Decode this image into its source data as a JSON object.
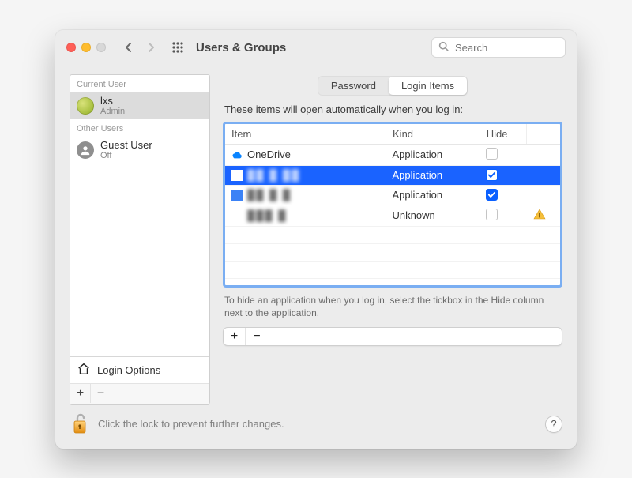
{
  "toolbar": {
    "title": "Users & Groups",
    "search_placeholder": "Search"
  },
  "sidebar": {
    "headers": {
      "current": "Current User",
      "other": "Other Users"
    },
    "current": {
      "name": "lxs",
      "role": "Admin"
    },
    "others": [
      {
        "name": "Guest User",
        "role": "Off"
      }
    ],
    "login_options_label": "Login Options"
  },
  "main": {
    "tabs": {
      "password": "Password",
      "login_items": "Login Items",
      "active": "login_items"
    },
    "description": "These items will open automatically when you log in:",
    "columns": {
      "item": "Item",
      "kind": "Kind",
      "hide": "Hide"
    },
    "rows": [
      {
        "name": "OneDrive",
        "kind": "Application",
        "hide": false,
        "icon": "cloud",
        "obscured": false,
        "selected": false,
        "warn": false
      },
      {
        "name": "",
        "kind": "Application",
        "hide": true,
        "icon": "generic",
        "obscured": true,
        "selected": true,
        "warn": false
      },
      {
        "name": "",
        "kind": "Application",
        "hide": true,
        "icon": "generic",
        "obscured": true,
        "selected": false,
        "warn": false
      },
      {
        "name": "",
        "kind": "Unknown",
        "hide": false,
        "icon": "generic",
        "obscured": true,
        "selected": false,
        "warn": true
      }
    ],
    "hint": "To hide an application when you log in, select the tickbox in the Hide column next to the application."
  },
  "footer": {
    "text": "Click the lock to prevent further changes.",
    "help": "?"
  }
}
